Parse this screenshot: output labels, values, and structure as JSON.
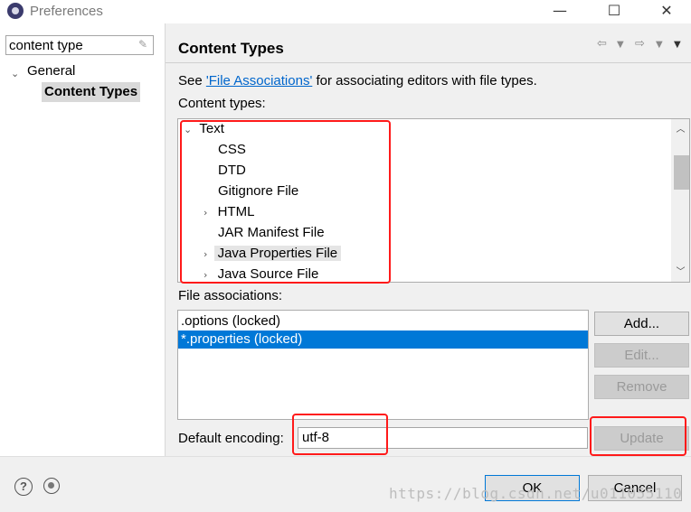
{
  "window": {
    "title": "Preferences",
    "minimize_glyph": "—",
    "maximize_glyph": "☐",
    "close_glyph": "✕"
  },
  "sidebar": {
    "filter_value": "content type",
    "items": [
      {
        "label": "General",
        "expanded": true
      },
      {
        "label": "Content Types",
        "selected": true
      }
    ]
  },
  "main": {
    "title": "Content Types",
    "see_prefix": "See ",
    "see_link": "'File Associations'",
    "see_suffix": " for associating editors with file types.",
    "content_types_label": "Content types:",
    "tree": [
      {
        "label": "Text",
        "expander": "down"
      },
      {
        "label": "CSS"
      },
      {
        "label": "DTD"
      },
      {
        "label": "Gitignore File"
      },
      {
        "label": "HTML",
        "expander": "right"
      },
      {
        "label": "JAR Manifest File"
      },
      {
        "label": "Java Properties File",
        "expander": "right",
        "selected": true
      },
      {
        "label": "Java Source File",
        "expander": "right"
      }
    ],
    "file_associations_label": "File associations:",
    "file_associations": [
      {
        "label": ".options (locked)"
      },
      {
        "label": "*.properties (locked)",
        "selected": true
      }
    ],
    "buttons": {
      "add": "Add...",
      "edit": "Edit...",
      "remove": "Remove",
      "update": "Update"
    },
    "default_encoding_label": "Default encoding:",
    "default_encoding_value": "utf-8"
  },
  "footer": {
    "ok": "OK",
    "cancel": "Cancel"
  },
  "watermark": "https://blog.csdn.net/u011055110",
  "colors": {
    "selection": "#0078d7",
    "annotation_red": "#ff1a1a",
    "link": "#0066cc"
  }
}
